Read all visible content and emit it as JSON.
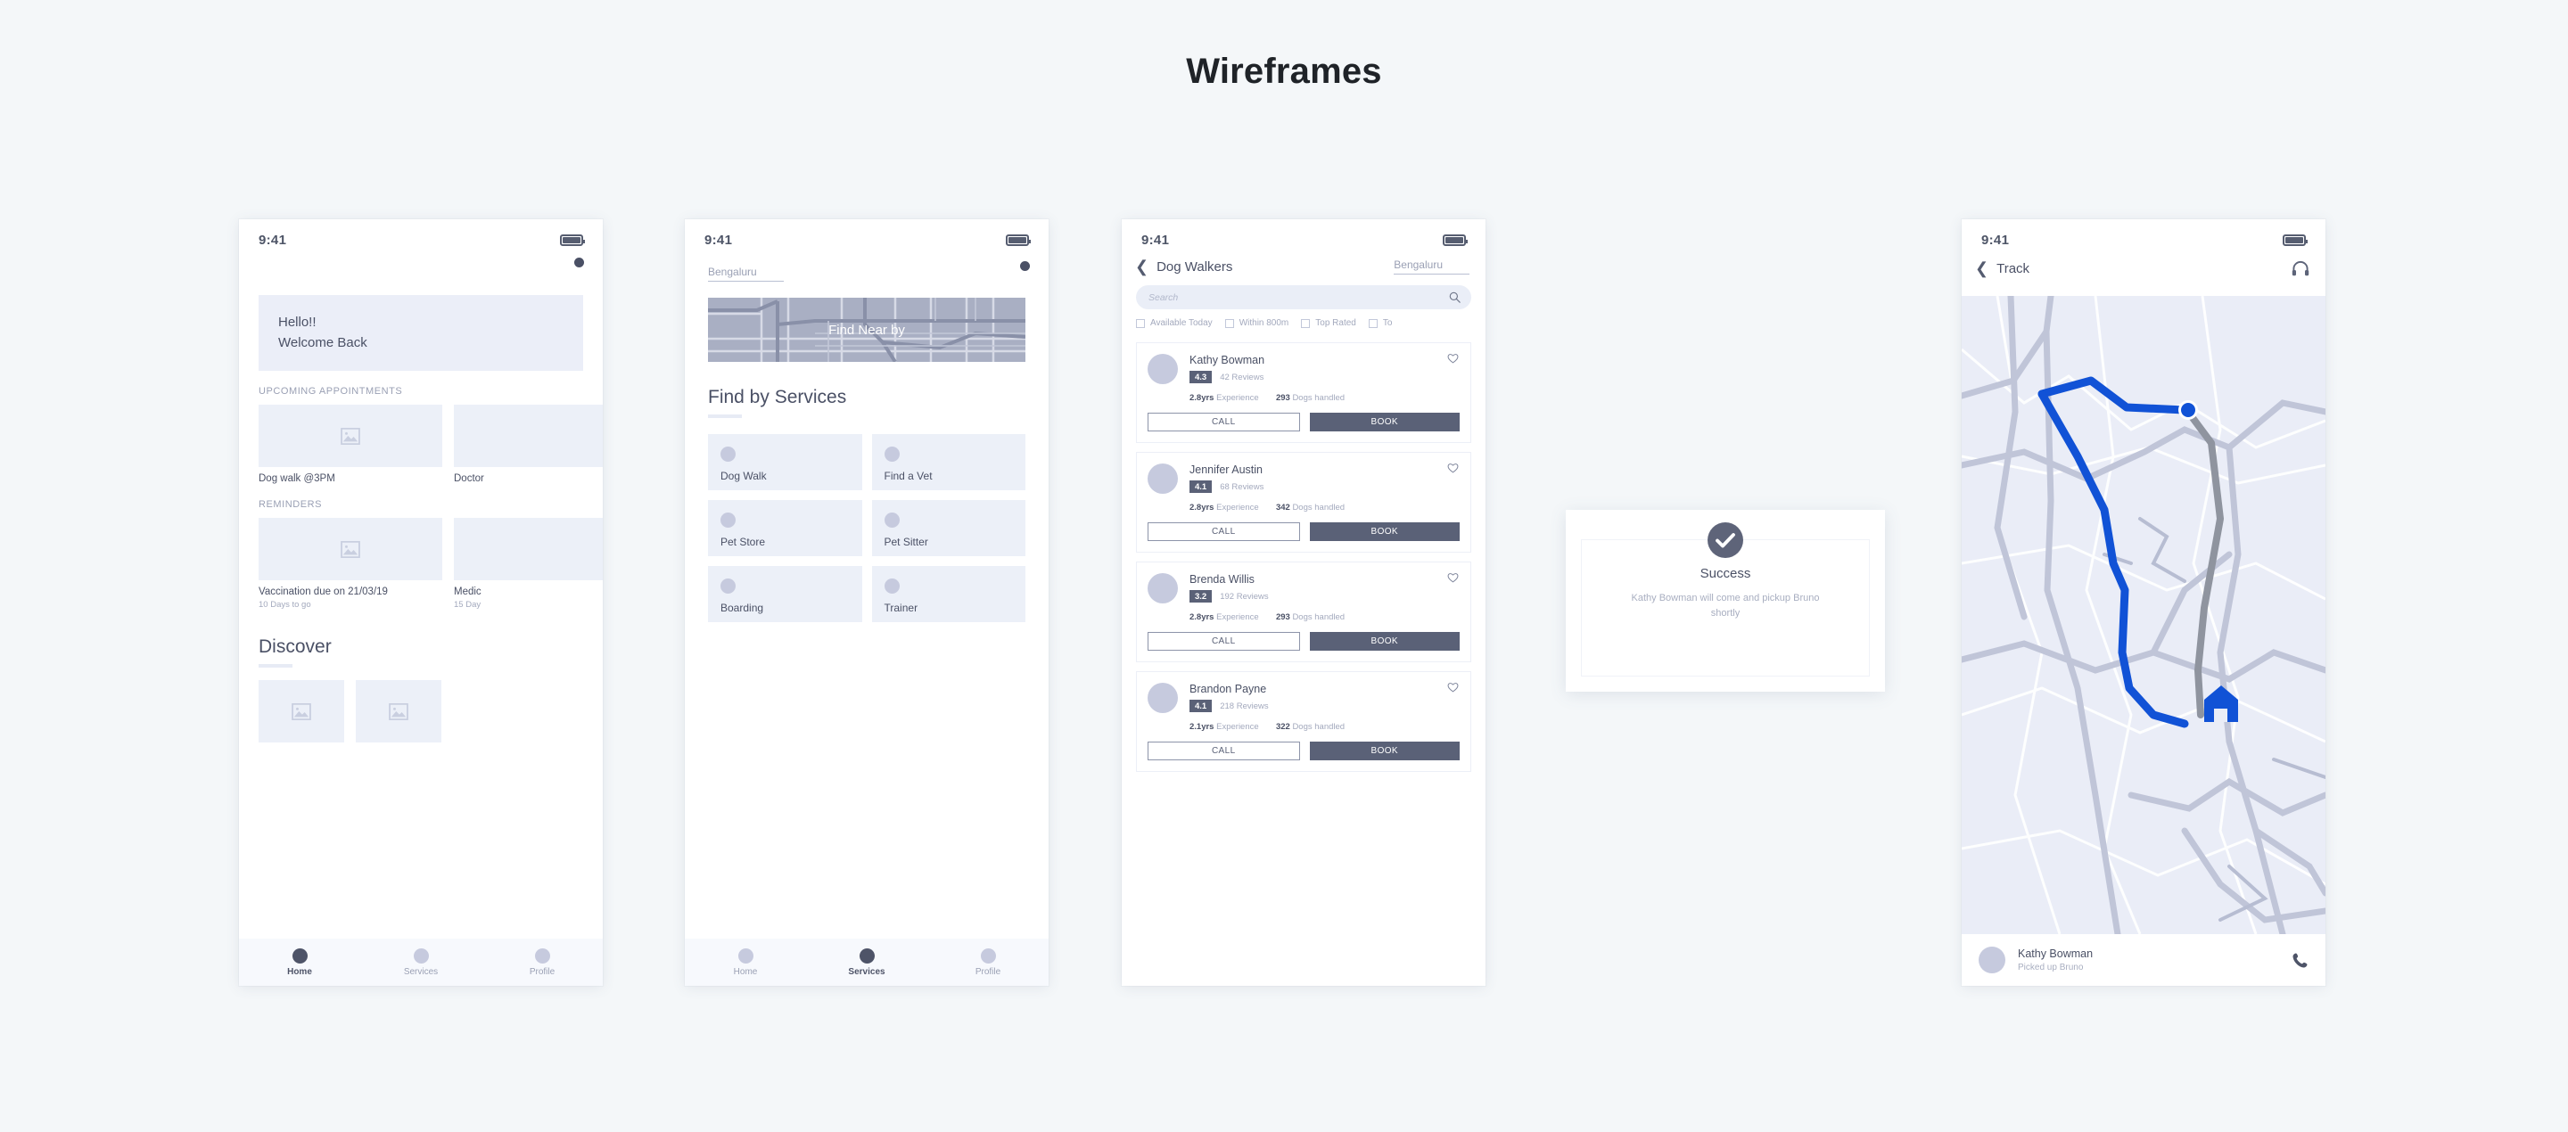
{
  "page": {
    "title": "Wireframes",
    "background": "#f4f7f9"
  },
  "colors": {
    "accent": "#5a6177",
    "muted": "#a3a9bd",
    "fill": "#ecf0f8",
    "route": "#1152d6"
  },
  "screen_home": {
    "status": {
      "time": "9:41",
      "battery_icon": "battery-icon"
    },
    "hero": {
      "line1": "Hello!!",
      "line2": "Welcome Back"
    },
    "appointments_caption": "UPCOMING APPOINTMENTS",
    "appointments": [
      {
        "title": "Dog walk @3PM"
      },
      {
        "title": "Doctor"
      }
    ],
    "reminders_caption": "REMINDERS",
    "reminders": [
      {
        "title": "Vaccination due on 21/03/19",
        "sub": "10 Days to go"
      },
      {
        "title": "Medic",
        "sub": "15 Day"
      }
    ],
    "discover_heading": "Discover",
    "nav": [
      {
        "label": "Home",
        "active": true
      },
      {
        "label": "Services",
        "active": false
      },
      {
        "label": "Profile",
        "active": false
      }
    ]
  },
  "screen_services": {
    "status": {
      "time": "9:41"
    },
    "city": "Bengaluru",
    "map_label": "Find Near by",
    "heading": "Find by Services",
    "services": [
      {
        "label": "Dog Walk"
      },
      {
        "label": "Find a Vet"
      },
      {
        "label": "Pet Store"
      },
      {
        "label": "Pet Sitter"
      },
      {
        "label": "Boarding"
      },
      {
        "label": "Trainer"
      }
    ],
    "nav": [
      {
        "label": "Home",
        "active": false
      },
      {
        "label": "Services",
        "active": true
      },
      {
        "label": "Profile",
        "active": false
      }
    ]
  },
  "screen_walkers": {
    "status": {
      "time": "9:41"
    },
    "title": "Dog Walkers",
    "city": "Bengaluru",
    "search_placeholder": "Search",
    "filters": [
      {
        "label": "Available Today",
        "checked": false
      },
      {
        "label": "Within 800m",
        "checked": false
      },
      {
        "label": "Top Rated",
        "checked": false
      },
      {
        "label": "To",
        "checked": false
      }
    ],
    "experience_label": "Experience",
    "dogs_label": "Dogs handled",
    "call_label": "CALL",
    "book_label": "BOOK",
    "walkers": [
      {
        "name": "Kathy Bowman",
        "rating": "4.3",
        "reviews": "42 Reviews",
        "experience": "2.8yrs",
        "dogs": "293"
      },
      {
        "name": "Jennifer Austin",
        "rating": "4.1",
        "reviews": "68 Reviews",
        "experience": "2.8yrs",
        "dogs": "342"
      },
      {
        "name": "Brenda Willis",
        "rating": "3.2",
        "reviews": "192 Reviews",
        "experience": "2.8yrs",
        "dogs": "293"
      },
      {
        "name": "Brandon Payne",
        "rating": "4.1",
        "reviews": "218 Reviews",
        "experience": "2.1yrs",
        "dogs": "322"
      }
    ]
  },
  "success_modal": {
    "icon": "check-circle-icon",
    "title": "Success",
    "message": "Kathy Bowman will come and pickup Bruno shortly"
  },
  "screen_track": {
    "status": {
      "time": "9:41"
    },
    "title": "Track",
    "support_icon": "headset-icon",
    "walker_name": "Kathy Bowman",
    "walker_status": "Picked up Bruno",
    "call_icon": "phone-icon"
  }
}
